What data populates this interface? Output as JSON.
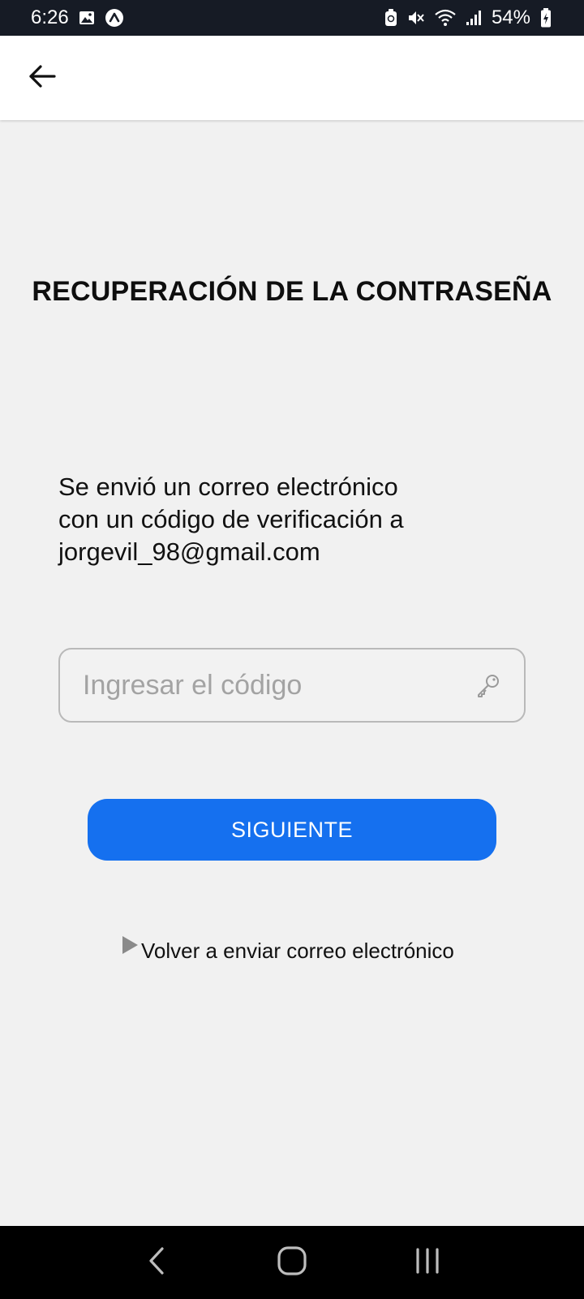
{
  "status_bar": {
    "time": "6:26",
    "battery": "54%",
    "icons": [
      "gallery-icon",
      "app-notification-icon",
      "battery-saver-icon",
      "mute-icon",
      "wifi-icon",
      "signal-icon",
      "battery-charging-icon"
    ]
  },
  "app_bar": {
    "back_icon": "arrow-left-icon"
  },
  "page": {
    "title": "RECUPERACIÓN DE LA CONTRASEÑA",
    "message_lines": [
      "Se envió un correo electrónico",
      "con un código de verificación a",
      "jorgevil_98@gmail.com"
    ],
    "code_input": {
      "value": "",
      "placeholder": "Ingresar el código",
      "icon": "key-icon"
    },
    "next_button_label": "SIGUIENTE",
    "resend_label": "Volver a enviar correo electrónico"
  },
  "nav_bar": {
    "buttons": [
      "back-nav-icon",
      "home-nav-icon",
      "recents-nav-icon"
    ]
  },
  "colors": {
    "status_bar_bg": "#161b25",
    "background": "#f1f1f1",
    "primary": "#1570ef",
    "nav_bar_bg": "#000000"
  }
}
